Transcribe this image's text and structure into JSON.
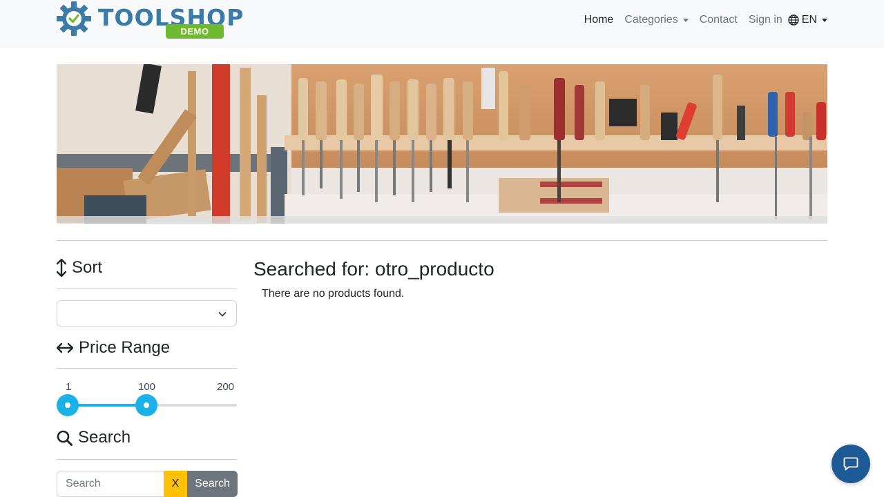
{
  "brand": {
    "name": "TOOLSHOP",
    "badge": "DEMO",
    "primary_color": "#3a7ba8",
    "badge_color": "#6fb92e"
  },
  "nav": {
    "home": "Home",
    "categories": "Categories",
    "contact": "Contact",
    "sign_in": "Sign in",
    "language": "EN",
    "language_icon": "globe-icon"
  },
  "sidebar": {
    "sort_heading": "Sort",
    "sort_icon": "arrows-vertical-icon",
    "sort_value": "",
    "price_heading": "Price Range",
    "price_icon": "arrows-horizontal-icon",
    "price_min_label": "1",
    "price_current_label": "100",
    "price_max_label": "200",
    "price_range": {
      "min": 1,
      "max": 200,
      "low": 1,
      "high": 100
    },
    "search_heading": "Search",
    "search_icon": "magnifier-icon",
    "search_placeholder": "Search",
    "search_value": "",
    "clear_label": "X",
    "search_button": "Search"
  },
  "main": {
    "title": "Searched for: otro_producto",
    "message": "There are no products found."
  },
  "colors": {
    "slider": "#1ab1e8",
    "clear_button": "#ffc107",
    "search_button": "#6c757d",
    "chat_button": "#1d5a96"
  },
  "chat": {
    "icon": "chat-bubble-icon"
  }
}
